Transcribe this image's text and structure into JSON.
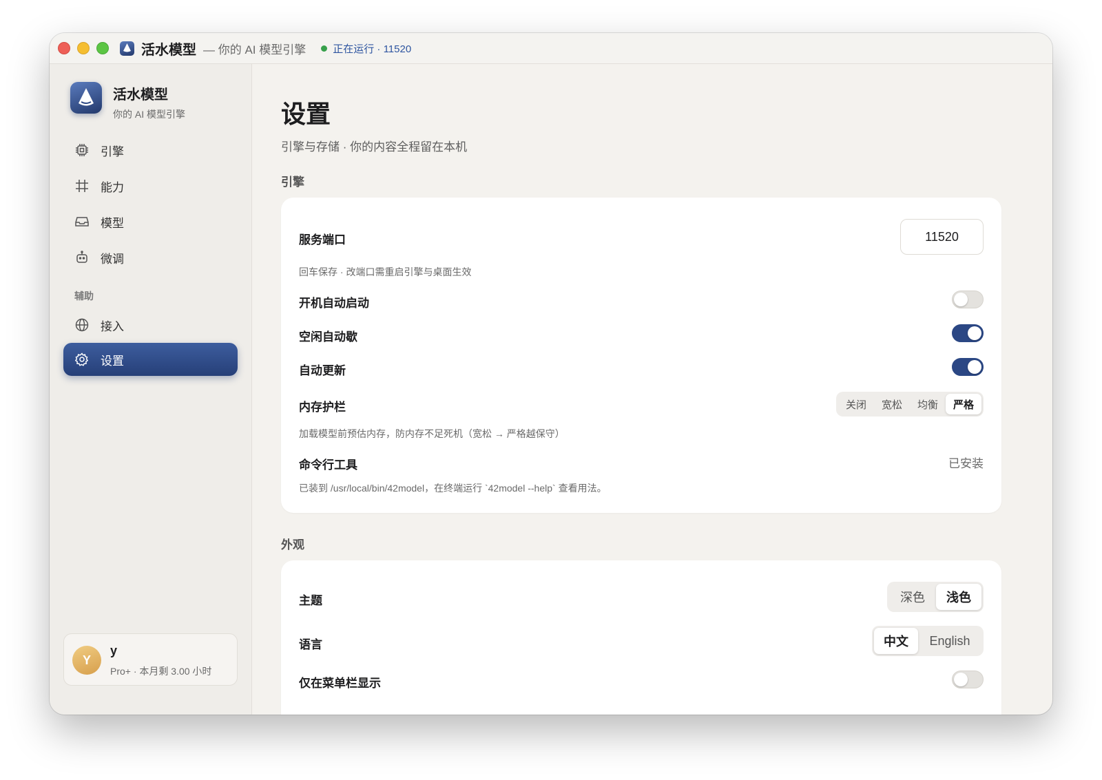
{
  "titlebar": {
    "app_name": "活水模型",
    "subtitle": "— 你的 AI 模型引擎",
    "status": "正在运行 · 11520"
  },
  "sidebar": {
    "brand_name": "活水模型",
    "brand_sub": "你的 AI 模型引擎",
    "items": [
      {
        "label": "引擎",
        "icon": "cpu-icon"
      },
      {
        "label": "能力",
        "icon": "hash-icon"
      },
      {
        "label": "模型",
        "icon": "inbox-icon"
      },
      {
        "label": "微调",
        "icon": "robot-icon"
      }
    ],
    "section_label": "辅助",
    "aux_items": [
      {
        "label": "接入",
        "icon": "globe-icon"
      },
      {
        "label": "设置",
        "icon": "gear-icon"
      }
    ],
    "user": {
      "initial": "Y",
      "name": "y",
      "plan": "Pro+ · 本月剩 3.00 小时"
    }
  },
  "main": {
    "title": "设置",
    "subtitle": "引擎与存储 · 你的内容全程留在本机",
    "engine": {
      "section_label": "引擎",
      "port_label": "服务端口",
      "port_value": "11520",
      "port_note": "回车保存 · 改端口需重启引擎与桌面生效",
      "autostart_label": "开机自动启动",
      "autostart_on": false,
      "idle_label": "空闲自动歇",
      "idle_on": true,
      "autoupdate_label": "自动更新",
      "autoupdate_on": true,
      "memguard_label": "内存护栏",
      "memguard_options": [
        "关闭",
        "宽松",
        "均衡",
        "严格"
      ],
      "memguard_selected": "严格",
      "memguard_note": "加载模型前预估内存，防内存不足死机（宽松 → 严格越保守）",
      "cli_label": "命令行工具",
      "cli_status": "已安装",
      "cli_note": "已装到 /usr/local/bin/42model，在终端运行 `42model --help` 查看用法。"
    },
    "appearance": {
      "section_label": "外观",
      "theme_label": "主题",
      "theme_options": [
        "深色",
        "浅色"
      ],
      "theme_selected": "浅色",
      "language_label": "语言",
      "language_options": [
        "中文",
        "English"
      ],
      "language_selected": "中文",
      "menubar_label": "仅在菜单栏显示",
      "menubar_on": false
    }
  },
  "colors": {
    "accent": "#2b4784",
    "status_green": "#37a04b",
    "status_text": "#2e55a0"
  }
}
